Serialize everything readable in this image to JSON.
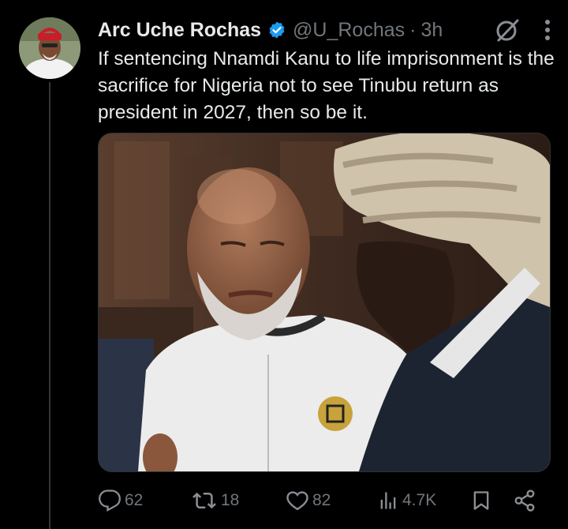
{
  "tweet": {
    "author_name": "Arc Uche Rochas",
    "handle": "@U_Rochas",
    "separator": "·",
    "time": "3h",
    "text": "If sentencing Nnamdi Kanu to life imprisonment is the sacrifice for Nigeria not to see Tinubu return as president in 2027, then so be it.",
    "verified": true
  },
  "icons": {
    "verified": "verified-badge-icon",
    "grok": "grok-icon",
    "more": "more-vertical-icon",
    "reply": "reply-icon",
    "retweet": "retweet-icon",
    "like": "heart-icon",
    "views": "views-icon",
    "bookmark": "bookmark-icon",
    "share": "share-icon"
  },
  "actions": {
    "replies": "62",
    "retweets": "18",
    "likes": "82",
    "views": "4.7K"
  },
  "colors": {
    "background": "#000000",
    "text": "#e7e9ea",
    "muted": "#71767b",
    "verified": "#1d9bf0"
  }
}
